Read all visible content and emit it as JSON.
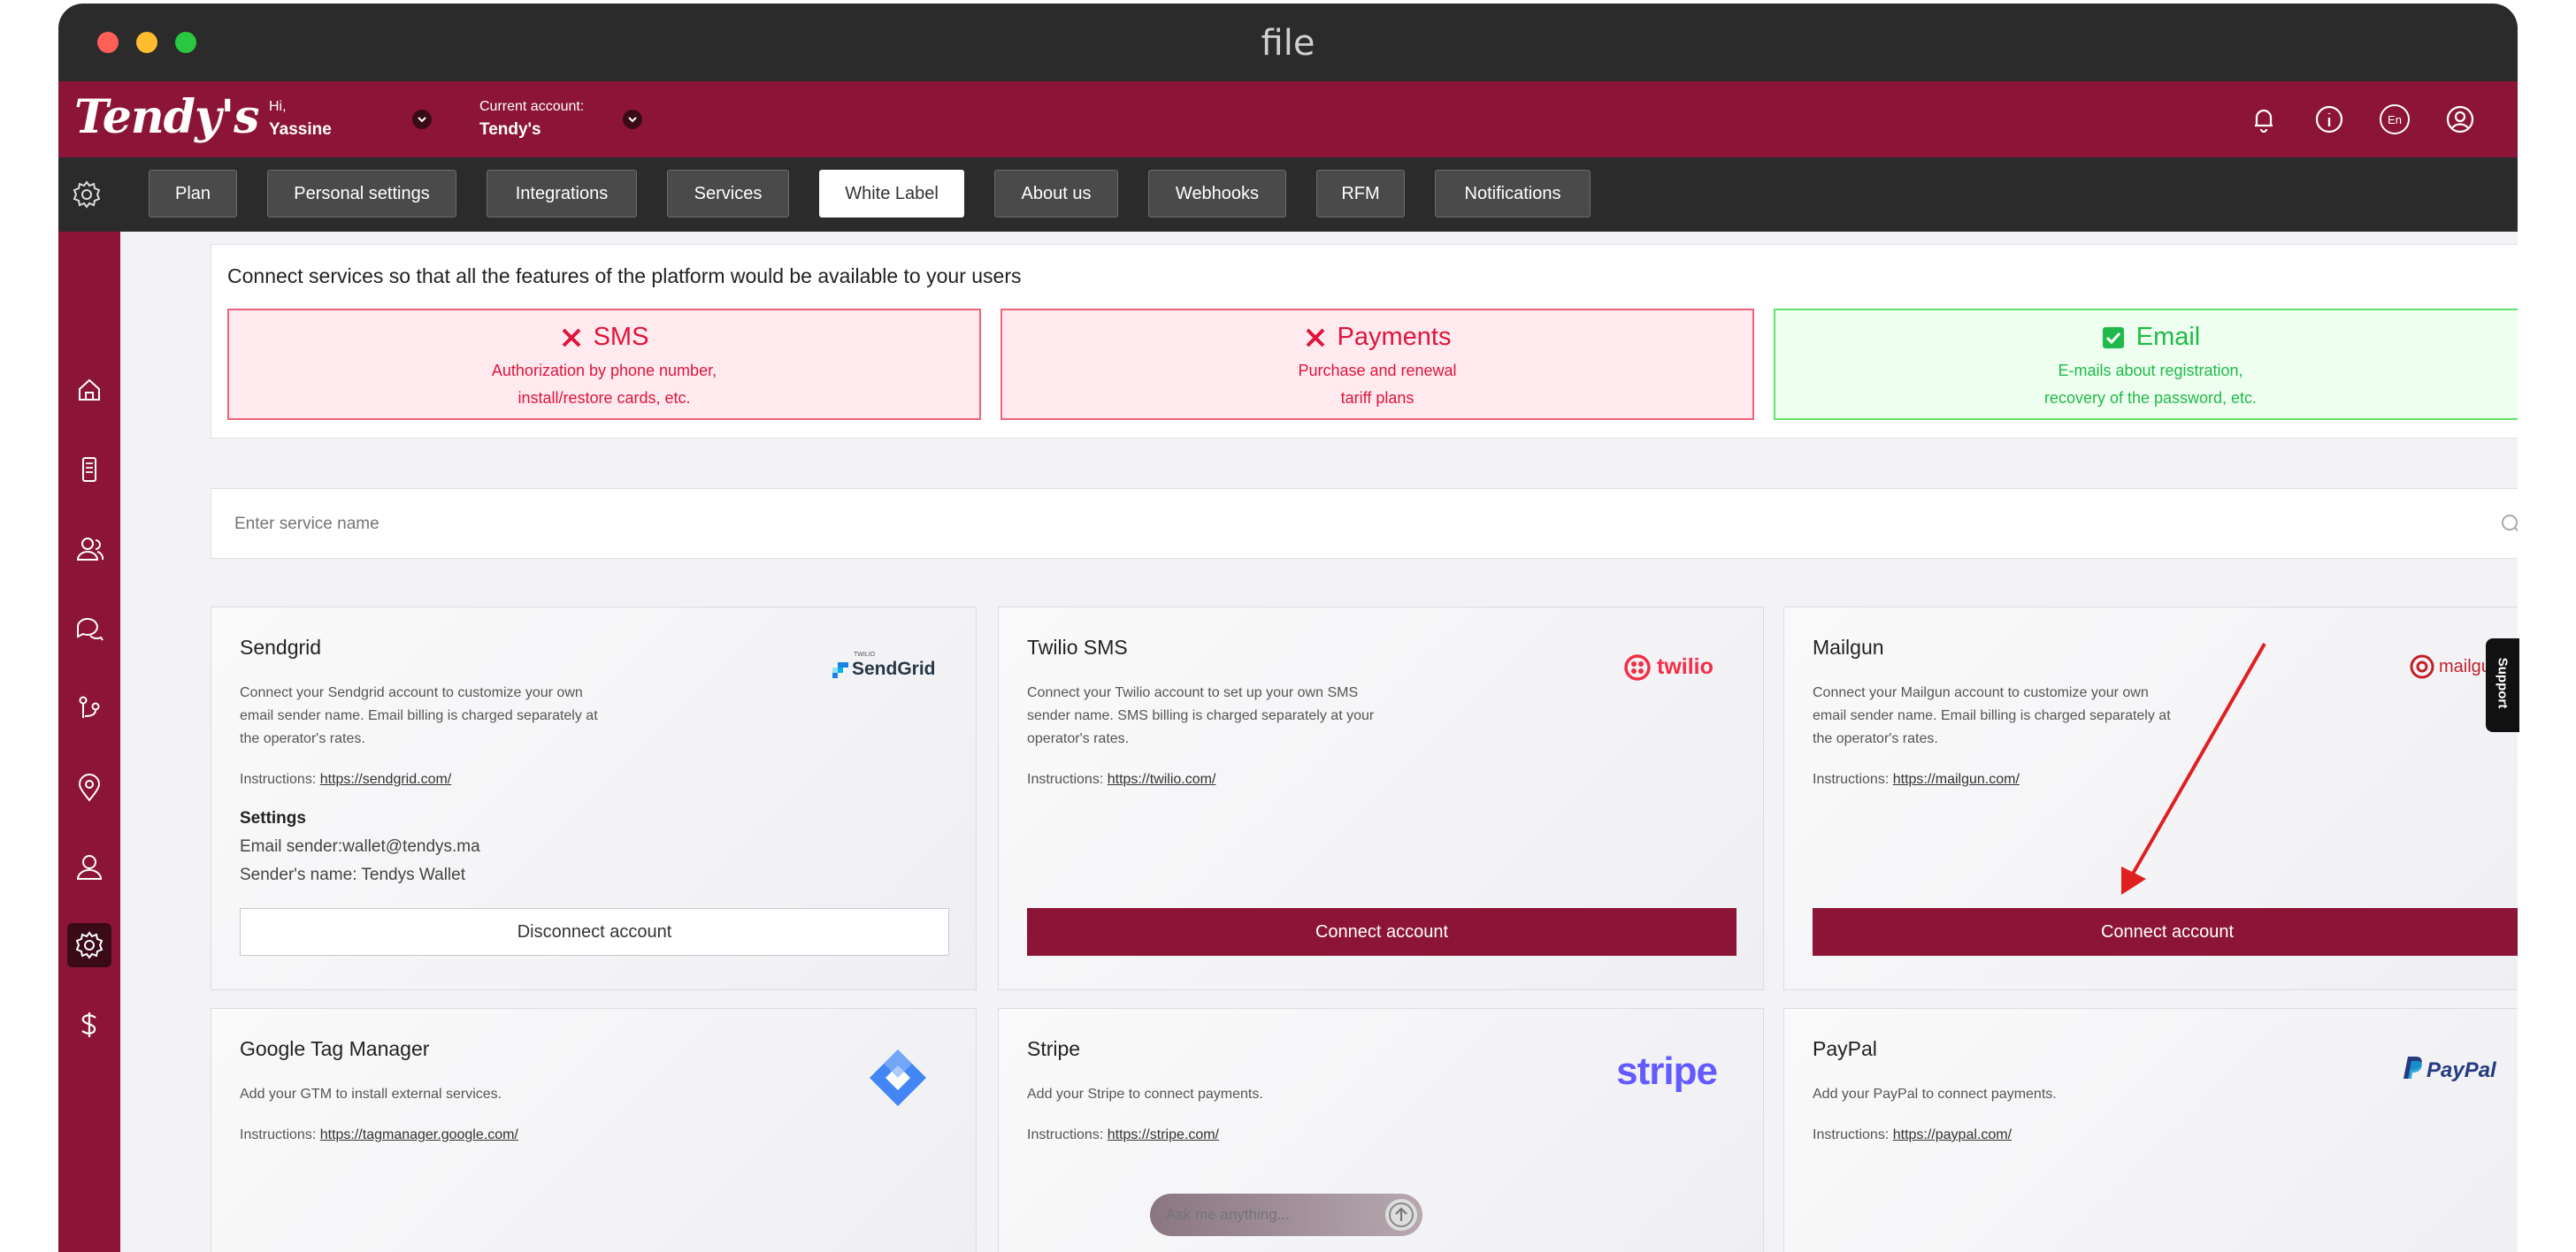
{
  "window": {
    "title": "file"
  },
  "header": {
    "logo_text": "Tendy's",
    "greeting": "Hi,",
    "user_name": "Yassine",
    "account_label": "Current account:",
    "account_name": "Tendy's"
  },
  "tabs": [
    "Plan",
    "Personal settings",
    "Integrations",
    "Services",
    "White Label",
    "About us",
    "Webhooks",
    "RFM",
    "Notifications"
  ],
  "active_tab": "White Label",
  "status": {
    "title": "Connect services so that all the features of the platform would be available to your users",
    "cards": [
      {
        "name": "SMS",
        "state": "disconnected",
        "line1": "Authorization by phone number,",
        "line2": "install/restore cards, etc."
      },
      {
        "name": "Payments",
        "state": "disconnected",
        "line1": "Purchase and renewal",
        "line2": "tariff plans"
      },
      {
        "name": "Email",
        "state": "connected",
        "line1": "E-mails about registration,",
        "line2": "recovery of the password, etc."
      }
    ]
  },
  "search": {
    "placeholder": "Enter service name"
  },
  "services": {
    "sendgrid": {
      "name": "Sendgrid",
      "desc": "Connect your Sendgrid account to customize your own email sender name. Email billing is charged separately at the operator's rates.",
      "instr_label": "Instructions:",
      "instr_link": "https://sendgrid.com/",
      "logo_small": "TWILIO",
      "logo_text": "SendGrid",
      "settings_title": "Settings",
      "sender_email_label": "Email sender:",
      "sender_email": "wallet@tendys.ma",
      "sender_name_label": "Sender's name:",
      "sender_name": "Tendys Wallet",
      "button": "Disconnect account"
    },
    "twilio": {
      "name": "Twilio SMS",
      "desc": "Connect your Twilio account to set up your own SMS sender name. SMS billing is charged separately at your operator's rates.",
      "instr_label": "Instructions:",
      "instr_link": "https://twilio.com/",
      "logo_text": "twilio",
      "button": "Connect account"
    },
    "mailgun": {
      "name": "Mailgun",
      "desc": "Connect your Mailgun account to customize your own email sender name. Email billing is charged separately at the operator's rates.",
      "instr_label": "Instructions:",
      "instr_link": "https://mailgun.com/",
      "logo_text": "mailgun",
      "button": "Connect account"
    },
    "gtm": {
      "name": "Google Tag Manager",
      "desc": "Add your GTM to install external services.",
      "instr_label": "Instructions:",
      "instr_link": "https://tagmanager.google.com/"
    },
    "stripe": {
      "name": "Stripe",
      "desc": "Add your Stripe to connect payments.",
      "instr_label": "Instructions:",
      "instr_link": "https://stripe.com/",
      "logo_text": "stripe"
    },
    "paypal": {
      "name": "PayPal",
      "desc": "Add your PayPal to connect payments.",
      "instr_label": "Instructions:",
      "instr_link": "https://paypal.com/",
      "logo_text": "PayPal"
    }
  },
  "support_label": "Support",
  "ask": {
    "placeholder": "Ask me anything..."
  },
  "lang": "En",
  "colors": {
    "brand": "#8c1537",
    "dark": "#2b2b2b",
    "error": "#e0143c",
    "success": "#21b94a",
    "annotation": "#e02020"
  },
  "icons": {
    "top": [
      "bell-icon",
      "info-icon",
      "language-icon",
      "user-icon"
    ],
    "sidebar": [
      "home-icon",
      "phone-icon",
      "users-icon",
      "chat-icon",
      "flow-icon",
      "location-icon",
      "profile-icon",
      "settings-icon",
      "dollar-icon"
    ]
  }
}
